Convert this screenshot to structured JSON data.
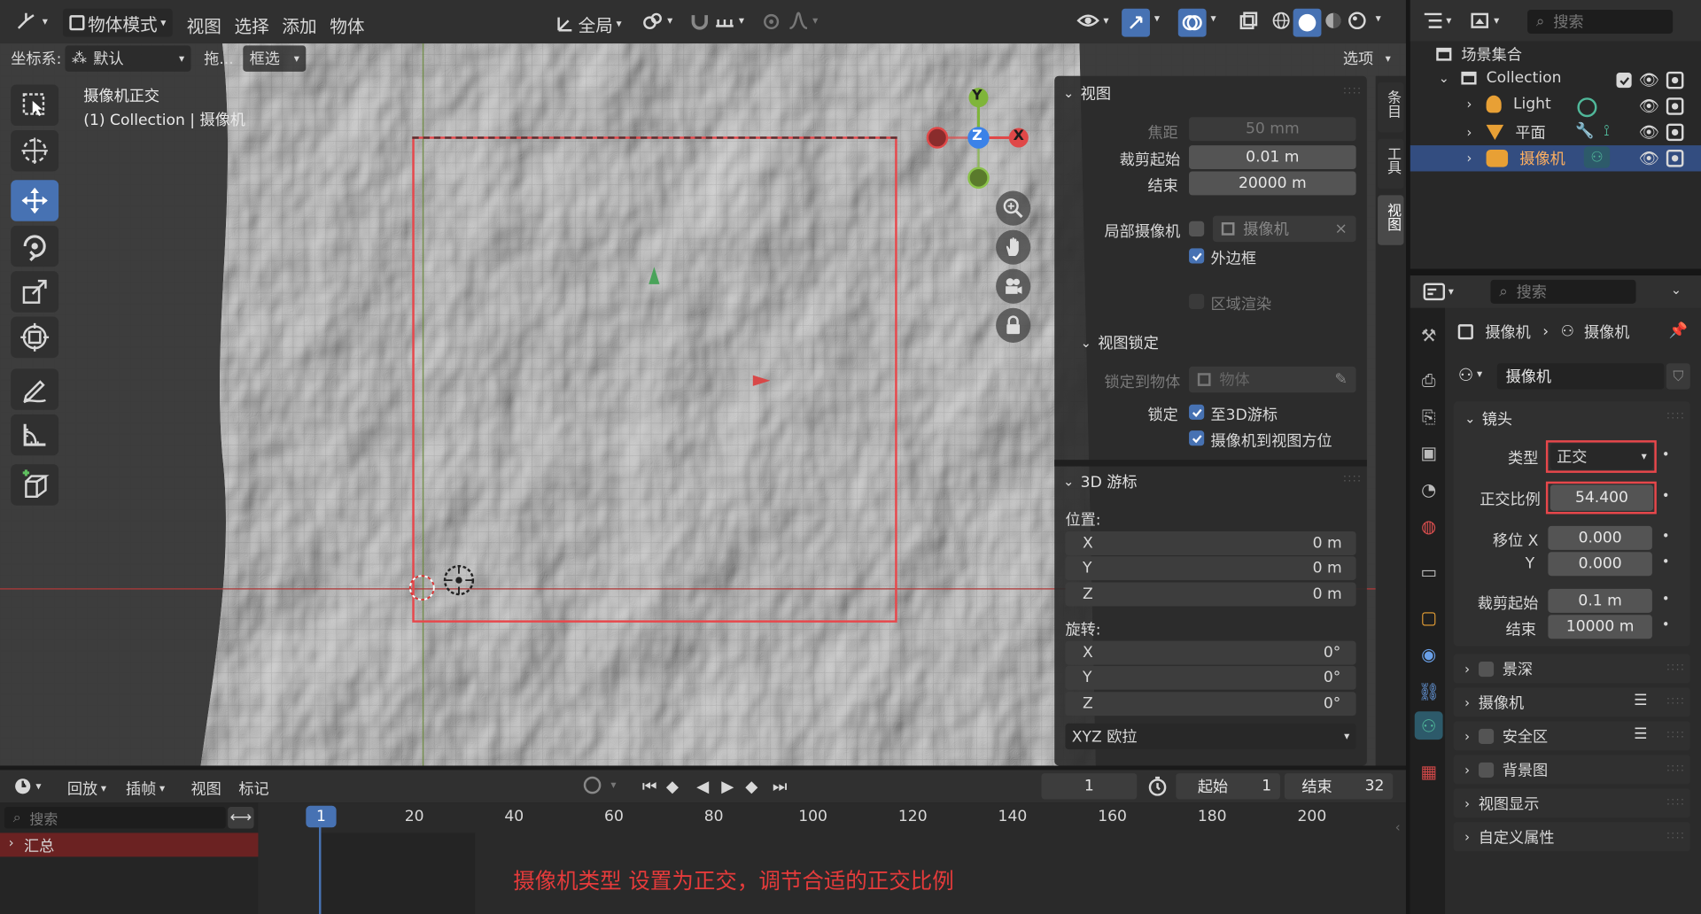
{
  "header": {
    "mode_label": "物体模式",
    "menus": [
      "视图",
      "选择",
      "添加",
      "物体"
    ],
    "transform_orientation": "全局"
  },
  "toolbar2": {
    "coord_label": "坐标系:",
    "coord_value": "默认",
    "drag_label": "拖...",
    "select_mode": "框选",
    "options_label": "选项"
  },
  "viewport": {
    "info_title": "摄像机正交",
    "info_sub": "(1) Collection | 摄像机",
    "gizmo": {
      "y": "Y",
      "z": "Z",
      "x": "X"
    }
  },
  "npanel": {
    "tabs": [
      "条目",
      "工具",
      "视图"
    ],
    "view_section": "视图",
    "focal_label": "焦距",
    "focal_value": "50 mm",
    "clip_start_label": "裁剪起始",
    "clip_start_value": "0.01 m",
    "clip_end_label": "结束",
    "clip_end_value": "20000 m",
    "local_camera_label": "局部摄像机",
    "local_camera_value": "摄像机",
    "outer_border_label": "外边框",
    "region_render_label": "区域渲染",
    "view_lock_section": "视图锁定",
    "lock_to_object_label": "锁定到物体",
    "lock_to_object_placeholder": "物体",
    "lock_label": "锁定",
    "lock_to_cursor_label": "至3D游标",
    "lock_camera_label": "摄像机到视图方位",
    "cursor_section": "3D 游标",
    "location_label": "位置:",
    "loc": [
      {
        "axis": "X",
        "value": "0 m"
      },
      {
        "axis": "Y",
        "value": "0 m"
      },
      {
        "axis": "Z",
        "value": "0 m"
      }
    ],
    "rotation_label": "旋转:",
    "rot": [
      {
        "axis": "X",
        "value": "0°"
      },
      {
        "axis": "Y",
        "value": "0°"
      },
      {
        "axis": "Z",
        "value": "0°"
      }
    ],
    "rotation_mode": "XYZ 欧拉"
  },
  "outliner": {
    "search_placeholder": "搜索",
    "scene_collection": "场景集合",
    "collection": "Collection",
    "items": [
      "Light",
      "平面",
      "摄像机"
    ]
  },
  "properties": {
    "search_placeholder": "搜索",
    "breadcrumb_object": "摄像机",
    "breadcrumb_data": "摄像机",
    "data_name": "摄像机",
    "lens_section": "镜头",
    "type_label": "类型",
    "type_value": "正交",
    "ortho_scale_label": "正交比例",
    "ortho_scale_value": "54.400",
    "shift_x_label": "移位 X",
    "shift_x_value": "0.000",
    "shift_y_label": "Y",
    "shift_y_value": "0.000",
    "clip_start_label": "裁剪起始",
    "clip_start_value": "0.1 m",
    "clip_end_label": "结束",
    "clip_end_value": "10000 m",
    "panels": [
      "景深",
      "摄像机",
      "安全区",
      "背景图",
      "视图显示",
      "自定义属性"
    ]
  },
  "timeline": {
    "menus": [
      "回放",
      "插帧",
      "视图",
      "标记"
    ],
    "current_frame": "1",
    "start_label": "起始",
    "start_value": "1",
    "end_label": "结束",
    "end_value": "32",
    "search_placeholder": "搜索",
    "summary_label": "汇总",
    "ruler": [
      "1",
      "20",
      "40",
      "60",
      "80",
      "100",
      "120",
      "140",
      "160",
      "180",
      "200"
    ],
    "annotation": "摄像机类型 设置为正交，调节合适的正交比例"
  },
  "colors": {
    "accent": "#4772b3",
    "highlight_red": "#e8474b",
    "annotation_red": "#e53b3b",
    "camera_green": "#50b89a"
  }
}
